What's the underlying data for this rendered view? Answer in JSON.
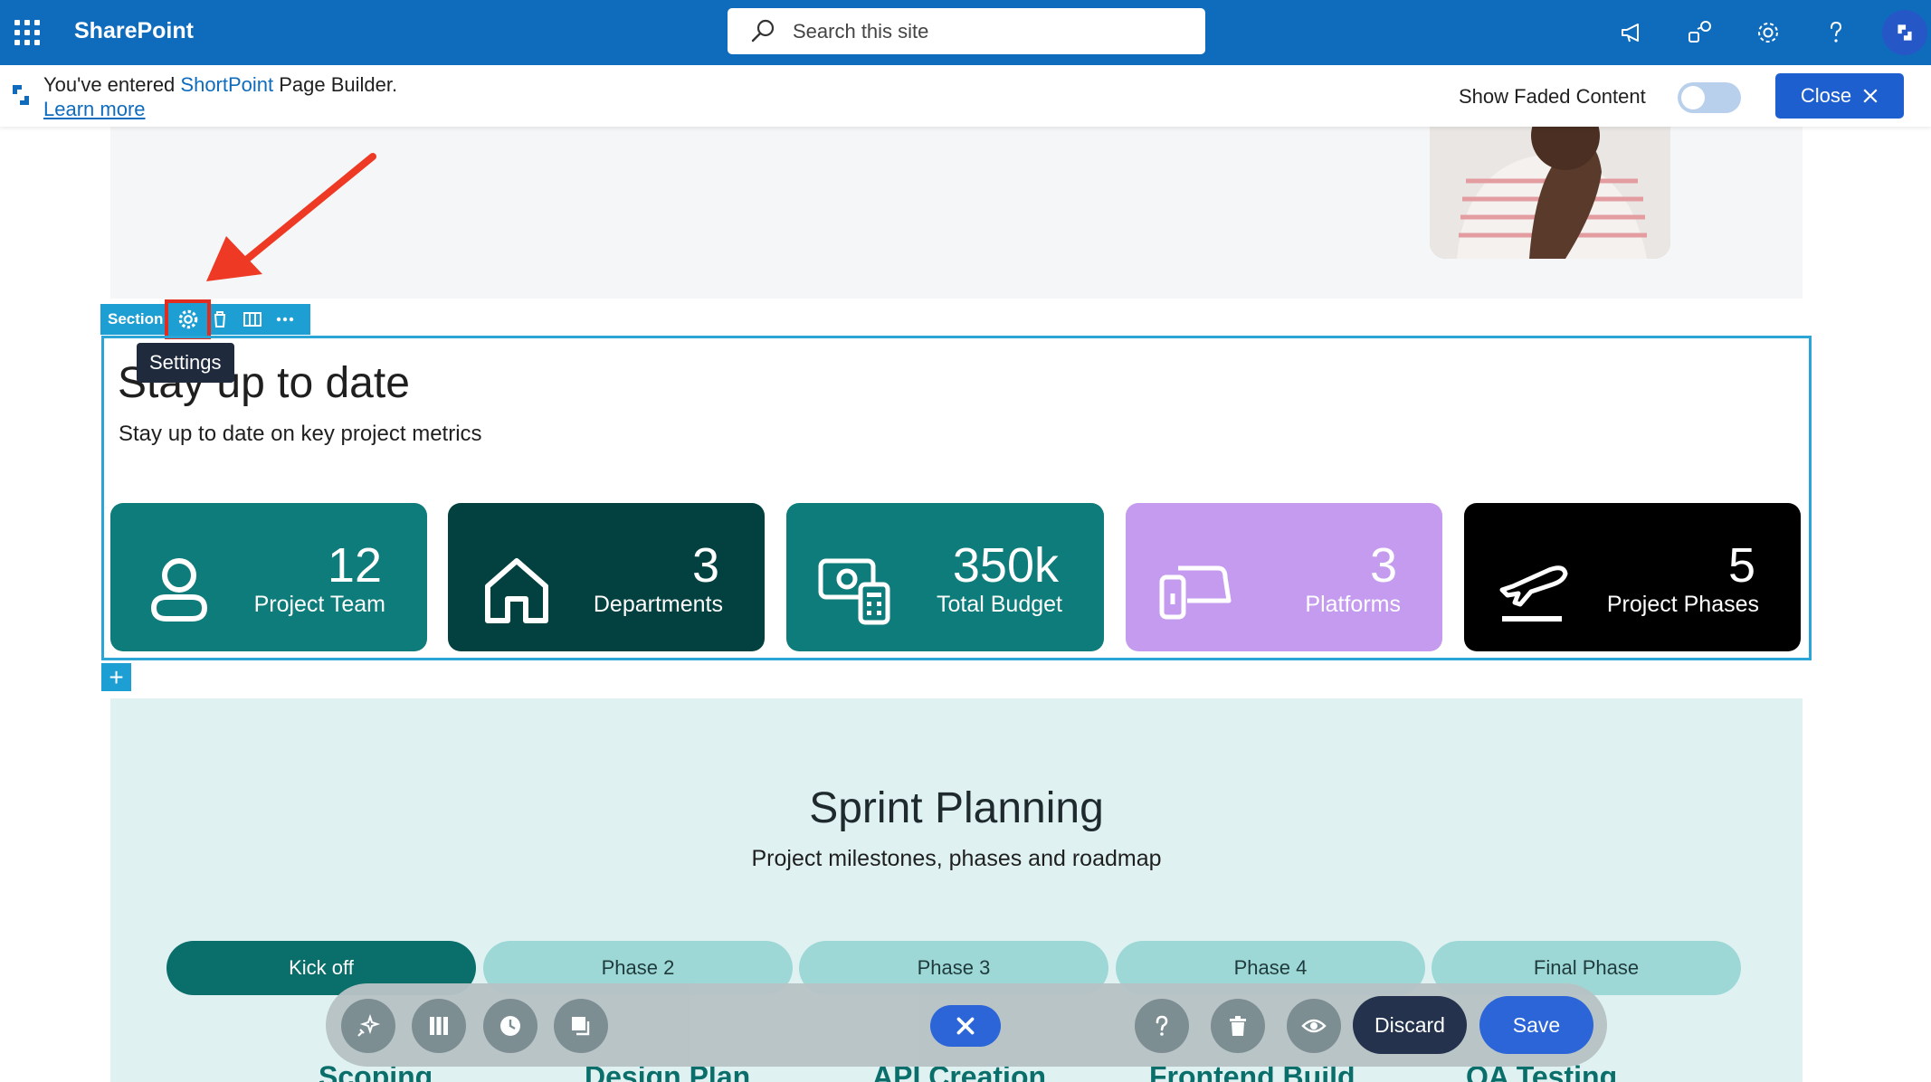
{
  "suite": {
    "app_name": "SharePoint",
    "search_placeholder": "Search this site",
    "icons": [
      "waffle-icon",
      "megaphone-icon",
      "share-icon",
      "gear-icon",
      "help-icon",
      "shortpoint-icon"
    ],
    "accent": "#0f6cbd"
  },
  "notice": {
    "prefix": "You've entered ",
    "brand": "ShortPoint",
    "suffix": " Page Builder.",
    "learn_more": "Learn more",
    "faded_label": "Show Faded Content",
    "faded_on": false,
    "close_label": "Close"
  },
  "section": {
    "toolbar_label": "Section",
    "tooltip": "Settings",
    "title": "Stay up to date",
    "subtitle": "Stay up to date on key project metrics",
    "cards": [
      {
        "value": "12",
        "label": "Project Team",
        "icon": "person-icon",
        "color": "#0d7c7a"
      },
      {
        "value": "3",
        "label": "Departments",
        "icon": "home-icon",
        "color": "#02413f"
      },
      {
        "value": "350k",
        "label": "Total Budget",
        "icon": "money-calculator-icon",
        "color": "#0d7c7a"
      },
      {
        "value": "3",
        "label": "Platforms",
        "icon": "devices-icon",
        "color": "#c59bef"
      },
      {
        "value": "5",
        "label": "Project Phases",
        "icon": "airplane-icon",
        "color": "#000000"
      }
    ]
  },
  "sprint": {
    "title": "Sprint Planning",
    "subtitle": "Project milestones, phases and roadmap",
    "tabs": [
      "Kick off",
      "Phase 2",
      "Phase 3",
      "Phase 4",
      "Final Phase"
    ],
    "active_tab": "Kick off",
    "milestones": [
      "Scoping",
      "Design Plan",
      "API Creation",
      "Frontend Build",
      "QA Testing"
    ]
  },
  "dock": {
    "discard_label": "Discard",
    "save_label": "Save",
    "icons": [
      "sparkle-icon",
      "columns-icon",
      "history-icon",
      "copy-icon",
      "close-icon",
      "help-icon",
      "trash-icon",
      "eye-icon"
    ]
  }
}
